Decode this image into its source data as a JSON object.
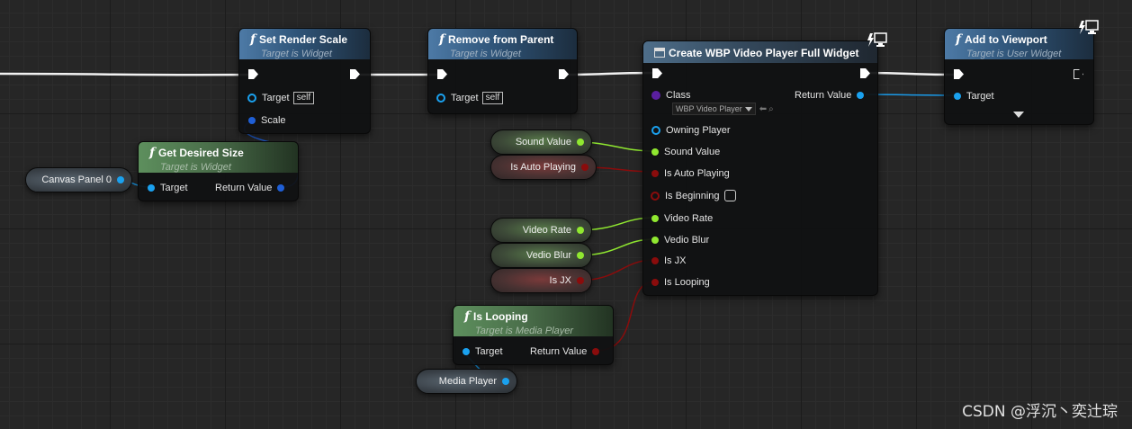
{
  "nodes": {
    "set_render_scale": {
      "title": "Set Render Scale",
      "subtitle": "Target is Widget",
      "target_label": "Target",
      "self_label": "self",
      "scale_label": "Scale"
    },
    "remove_from_parent": {
      "title": "Remove from Parent",
      "subtitle": "Target is Widget",
      "target_label": "Target",
      "self_label": "self"
    },
    "create_widget": {
      "title": "Create WBP Video Player Full Widget",
      "class_label": "Class",
      "class_value": "WBP Video Player",
      "return_label": "Return Value",
      "owning_player_label": "Owning Player",
      "sound_value_label": "Sound Value",
      "is_auto_playing_label": "Is Auto Playing",
      "is_beginning_label": "Is Beginning",
      "video_rate_label": "Video Rate",
      "vedio_blur_label": "Vedio Blur",
      "is_jx_label": "Is JX",
      "is_looping_label": "Is Looping"
    },
    "add_to_viewport": {
      "title": "Add to Viewport",
      "subtitle": "Target is User Widget",
      "target_label": "Target"
    },
    "get_desired_size": {
      "title": "Get Desired Size",
      "subtitle": "Target is Widget",
      "target_label": "Target",
      "return_label": "Return Value"
    },
    "is_looping": {
      "title": "Is Looping",
      "subtitle": "Target is Media Player",
      "target_label": "Target",
      "return_label": "Return Value"
    }
  },
  "variables": {
    "canvas_panel": "Canvas Panel 0",
    "sound_value": "Sound Value",
    "is_auto_playing": "Is Auto Playing",
    "video_rate": "Video Rate",
    "vedio_blur": "Vedio Blur",
    "is_jx": "Is JX",
    "media_player": "Media  Player"
  },
  "colors": {
    "object_pin": "#1aa1ef",
    "float_pin": "#90e830",
    "bool_pin": "#8a0c0c",
    "exec_wire": "#ffffff",
    "vector_pin": "#1f5fd6"
  },
  "watermark": "CSDN @浮沉丶奕辻琮"
}
